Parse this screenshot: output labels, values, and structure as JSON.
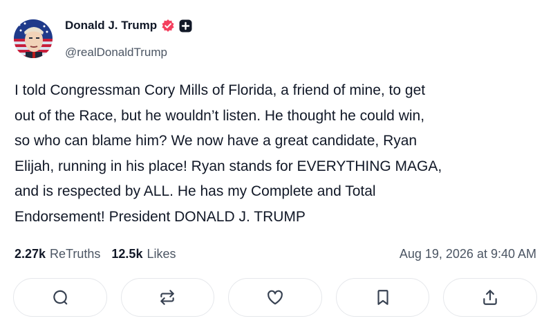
{
  "author": {
    "display_name": "Donald J. Trump",
    "handle": "@realDonaldTrump",
    "verified_icon": "verified-badge-icon",
    "plus_badge_icon": "plus-badge-icon"
  },
  "post": {
    "lines": [
      "I told Congressman Cory Mills of Florida, a friend of mine, to get",
      "out of the Race, but he wouldn’t listen. He thought he could win,",
      "so who can blame him? We now have a great candidate, Ryan",
      "Elijah, running in his place! Ryan stands for EVERYTHING MAGA,",
      "and is respected by ALL. He has my Complete and Total",
      "Endorsement! President DONALD J. TRUMP"
    ]
  },
  "stats": {
    "retruths_count": "2.27k",
    "retruths_label": "ReTruths",
    "likes_count": "12.5k",
    "likes_label": "Likes",
    "timestamp": "Aug 19, 2026 at 9:40 AM"
  },
  "actions": [
    "reply-icon",
    "retruth-icon",
    "like-icon",
    "bookmark-icon",
    "share-icon"
  ],
  "colors": {
    "verified": "#f43f5e",
    "text": "#111827",
    "muted": "#4b5563",
    "border": "#e5e7eb",
    "icon": "#374151"
  }
}
